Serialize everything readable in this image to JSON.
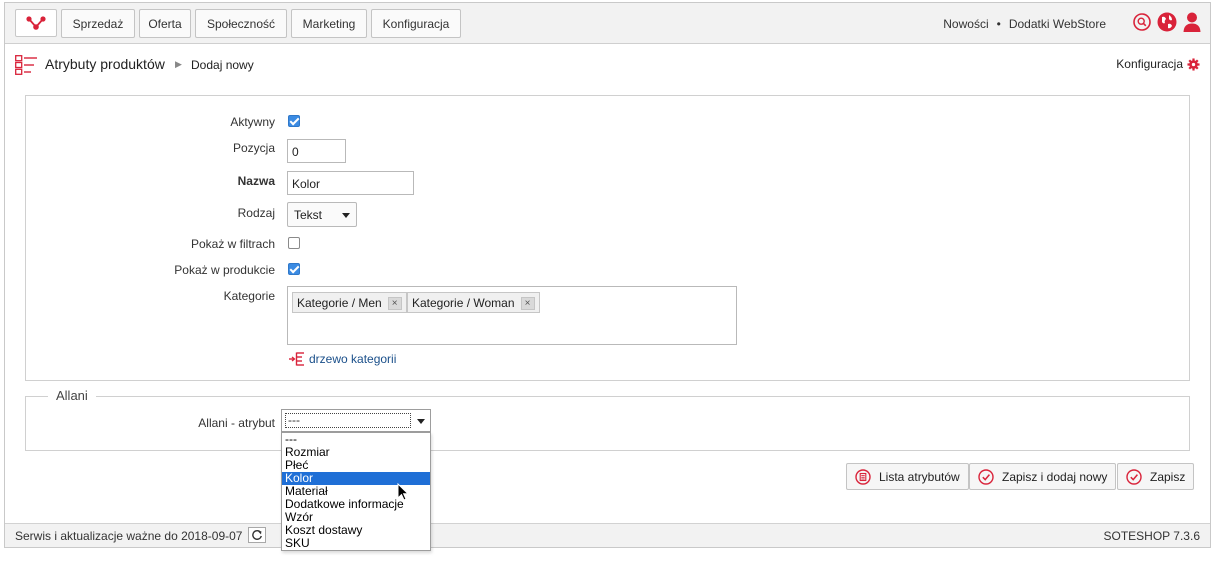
{
  "topnav": {
    "items": [
      "Sprzedaż",
      "Oferta",
      "Społeczność",
      "Marketing",
      "Konfiguracja"
    ],
    "links": [
      "Nowości",
      "Dodatki WebStore"
    ],
    "separator": "•"
  },
  "breadcrumb": {
    "section": "Atrybuty produktów",
    "current": "Dodaj nowy",
    "config_label": "Konfiguracja"
  },
  "form": {
    "active_label": "Aktywny",
    "active_checked": true,
    "position_label": "Pozycja",
    "position_value": "0",
    "name_label": "Nazwa",
    "name_value": "Kolor",
    "type_label": "Rodzaj",
    "type_value": "Tekst",
    "show_filters_label": "Pokaż w filtrach",
    "show_filters_checked": false,
    "show_product_label": "Pokaż w produkcie",
    "show_product_checked": true,
    "categories_label": "Kategorie",
    "categories": [
      "Kategorie / Men",
      "Kategorie / Woman"
    ],
    "tag_remove": "×",
    "tree_link": "drzewo kategorii"
  },
  "allani": {
    "legend": "Allani",
    "attr_label": "Allani - atrybut",
    "selected_value": "---",
    "options": [
      "---",
      "Rozmiar",
      "Płeć",
      "Kolor",
      "Materiał",
      "Dodatkowe informacje",
      "Wzór",
      "Koszt dostawy",
      "SKU"
    ],
    "highlighted_option": "Kolor"
  },
  "actions": {
    "list_label": "Lista atrybutów",
    "save_add_label": "Zapisz i dodaj nowy",
    "save_label": "Zapisz"
  },
  "footer": {
    "service_text": "Serwis i aktualizacje ważne do 2018-09-07",
    "version": "SOTESHOP 7.3.6"
  },
  "colors": {
    "accent_red": "#d9233a",
    "checkbox_blue": "#3b8be3",
    "highlight_blue": "#1f6fd6",
    "link_blue": "#1a4f8a"
  }
}
